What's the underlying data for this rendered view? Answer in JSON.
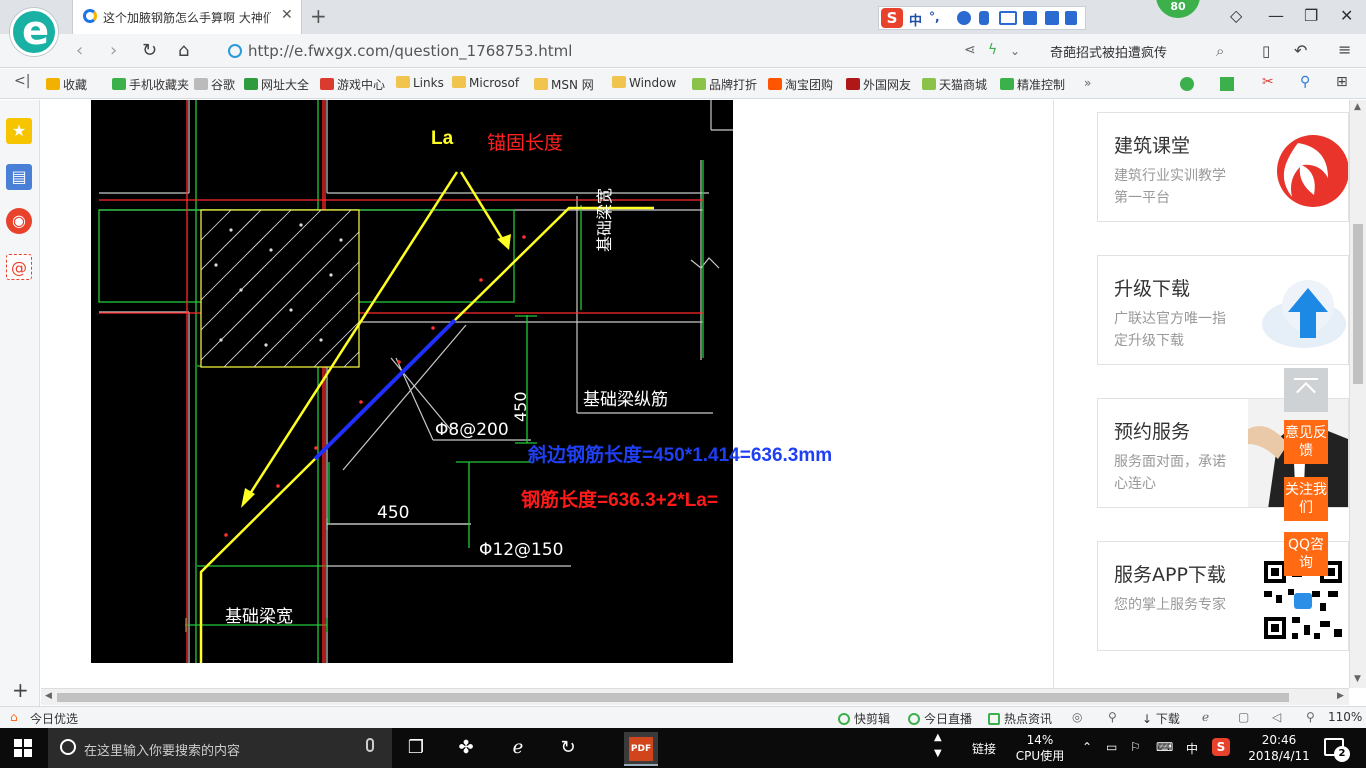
{
  "browser": {
    "tab_title": "这个加腋钢筋怎么手算啊 大神们",
    "tab_close": "✕",
    "new_tab": "+",
    "ime_badge": "S",
    "ime_mode": "中",
    "ime_punct": "°,",
    "score_badge": "80",
    "url": "http://e.fwxgx.com/question_1768753.html",
    "address_hot_text": "奇葩招式被拍遭疯传",
    "bookmarks": [
      {
        "label": "收藏",
        "icon": "star-icon",
        "color": "#f2b000"
      },
      {
        "label": "手机收藏夹",
        "icon": "phone-icon",
        "color": "#3cb04a"
      },
      {
        "label": "谷歌",
        "icon": "page-icon",
        "color": "#bbbbbb"
      },
      {
        "label": "网址大全",
        "icon": "globe-icon",
        "color": "#2e9b3e"
      },
      {
        "label": "游戏中心",
        "icon": "game-icon",
        "color": "#d93b2f"
      },
      {
        "label": "Links",
        "icon": "folder-icon",
        "color": "#f1c44d"
      },
      {
        "label": "Microsof",
        "icon": "folder-icon",
        "color": "#f1c44d"
      },
      {
        "label": "MSN 网",
        "icon": "folder-icon",
        "color": "#f1c44d"
      },
      {
        "label": "Window",
        "icon": "folder-icon",
        "color": "#f1c44d"
      },
      {
        "label": "品牌打折",
        "icon": "leaf-icon",
        "color": "#8bc34a"
      },
      {
        "label": "淘宝团购",
        "icon": "taobao-icon",
        "color": "#ff5500"
      },
      {
        "label": "外国网友",
        "icon": "flag-icon",
        "color": "#b01818"
      },
      {
        "label": "天猫商城",
        "icon": "leaf-icon",
        "color": "#8bc34a"
      },
      {
        "label": "精准控制",
        "icon": "chat-icon",
        "color": "#3cb04a"
      }
    ]
  },
  "drawing": {
    "label_la": "La",
    "label_anchor": "锚固长度",
    "label_beam_width_right": "基础梁宽",
    "label_beam_width_bottom": "基础梁宽",
    "label_long_bar": "基础梁纵筋",
    "label_stirrup": "Φ8@200",
    "label_bottom_bar": "Φ12@150",
    "dim_vertical": "450",
    "dim_horizontal": "450",
    "formula_diagonal": "斜边钢筋长度=450*1.414=636.3mm",
    "formula_total": "钢筋长度=636.3+2*La=",
    "colors": {
      "la": "#ffff00",
      "anchor": "#ff2020",
      "diagonal": "#1f3ff5",
      "total": "#ff1a1a"
    }
  },
  "side_cards": [
    {
      "title": "建筑课堂",
      "desc": "建筑行业实训教学第一平台",
      "icon": "swirl-logo-icon"
    },
    {
      "title": "升级下载",
      "desc": "广联达官方唯一指定升级下载",
      "icon": "cloud-upload-icon"
    },
    {
      "title": "预约服务",
      "desc": "服务面对面，承诺心连心",
      "icon": "service-person-icon"
    },
    {
      "title": "服务APP下载",
      "desc": "您的掌上服务专家",
      "icon": "qr-code-icon"
    }
  ],
  "float_buttons": [
    "意见反馈",
    "关注我们",
    "QQ咨询"
  ],
  "status_bar": {
    "left": "今日优选",
    "items": [
      "快剪辑",
      "今日直播",
      "热点资讯"
    ],
    "download": "下载",
    "zoom": "110%"
  },
  "taskbar": {
    "search_placeholder": "在这里输入你要搜索的内容",
    "tray_link": "链接",
    "cpu_percent": "14%",
    "cpu_label": "CPU使用",
    "ime": "中",
    "time": "20:46",
    "date": "2018/4/11",
    "notifications": "2"
  }
}
